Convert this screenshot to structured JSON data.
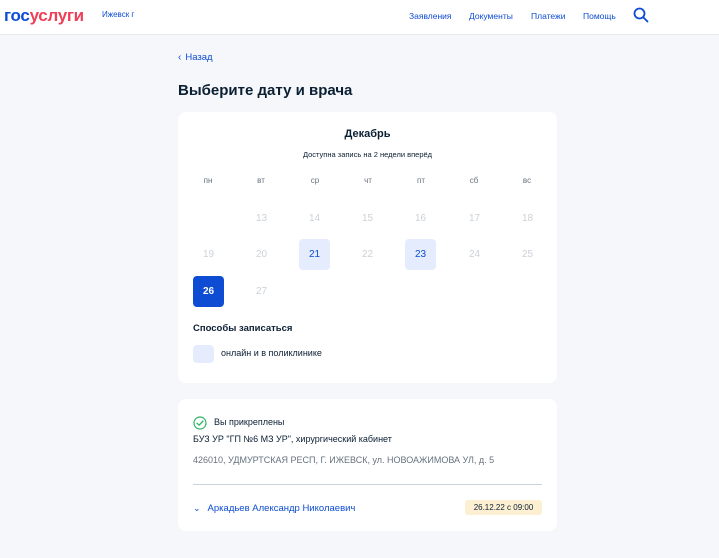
{
  "header": {
    "logo_part1": "гос",
    "logo_part2": "услуги",
    "city": "Ижевск г",
    "nav": [
      "Заявления",
      "Документы",
      "Платежи",
      "Помощь"
    ],
    "search_icon": "search-icon"
  },
  "back_label": "Назад",
  "page_title": "Выберите дату и врача",
  "calendar": {
    "month": "Декабрь",
    "subtitle": "Доступна запись на 2 недели вперёд",
    "weekdays": [
      "пн",
      "вт",
      "ср",
      "чт",
      "пт",
      "сб",
      "вс"
    ],
    "week1": [
      "13",
      "14",
      "15",
      "16",
      "17",
      "18"
    ],
    "week2": [
      "19",
      "20",
      "21",
      "22",
      "23",
      "24",
      "25"
    ],
    "week3": [
      "26",
      "27"
    ],
    "available_days": [
      "21",
      "23"
    ],
    "selected_day": "26"
  },
  "methods": {
    "title": "Способы записаться",
    "option": "онлайн и в поликлинике"
  },
  "attachment": {
    "status": "Вы прикреплены",
    "organization": "БУЗ УР \"ГП №6 МЗ УР\", хирургический кабинет",
    "address": "426010, УДМУРТСКАЯ РЕСП, Г. ИЖЕВСК, ул. НОВОАЖИМОВА УЛ, д. 5"
  },
  "doctor": {
    "name": "Аркадьев Александр Николаевич",
    "slot": "26.12.22 с 09:00"
  },
  "colors": {
    "primary": "#0d4cd3",
    "logo_accent": "#ee3f58",
    "available_bg": "#e4ecfd",
    "slot_bg": "#fdefd1",
    "success": "#2fb565"
  }
}
